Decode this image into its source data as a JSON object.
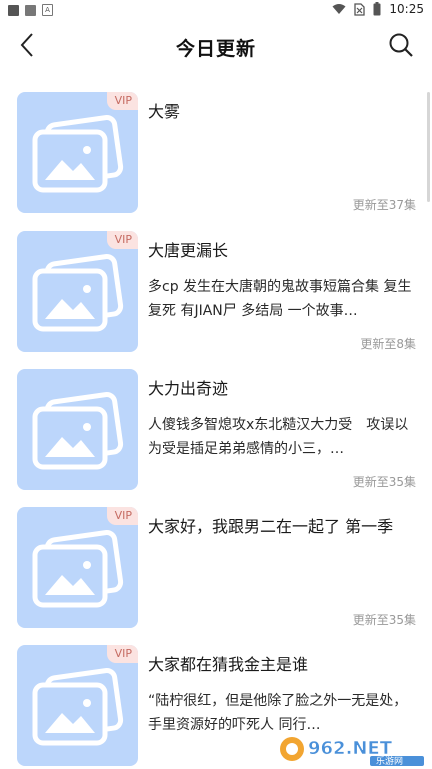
{
  "status_bar": {
    "time": "10:25",
    "left_icons": [
      "notification-square-icon",
      "notification-square-icon",
      "app-a-icon"
    ],
    "right_icons": [
      "wifi-icon",
      "no-sim-icon",
      "battery-icon"
    ]
  },
  "header": {
    "title": "今日更新",
    "back_icon": "chevron-left-icon",
    "search_icon": "search-icon"
  },
  "books": [
    {
      "title": "大雾",
      "vip": "VIP",
      "description": "",
      "update": "更新至37集"
    },
    {
      "title": "大唐更漏长",
      "vip": "VIP",
      "description": "多cp 发生在大唐朝的鬼故事短篇合集 复生复死 有JIAN尸 多结局 一个故事…",
      "update": "更新至8集"
    },
    {
      "title": "大力出奇迹",
      "vip": "",
      "description": "人傻钱多智熄攻x东北糙汉大力受　攻误以为受是插足弟弟感情的小三，…",
      "update": "更新至35集"
    },
    {
      "title": "大家好，我跟男二在一起了 第一季",
      "vip": "VIP",
      "description": "",
      "update": "更新至35集"
    },
    {
      "title": "大家都在猜我金主是谁",
      "vip": "VIP",
      "description": "“陆柠很红，但是他除了脸之外一无是处，手里资源好的吓死人 同行…",
      "update": ""
    }
  ],
  "watermark": {
    "text": "962.NET",
    "subtext": "乐游网"
  },
  "colors": {
    "cover_bg": "#bcd6fb",
    "vip_bg": "#fbe3e1",
    "vip_text": "#c56b62",
    "muted_text": "#999999"
  }
}
